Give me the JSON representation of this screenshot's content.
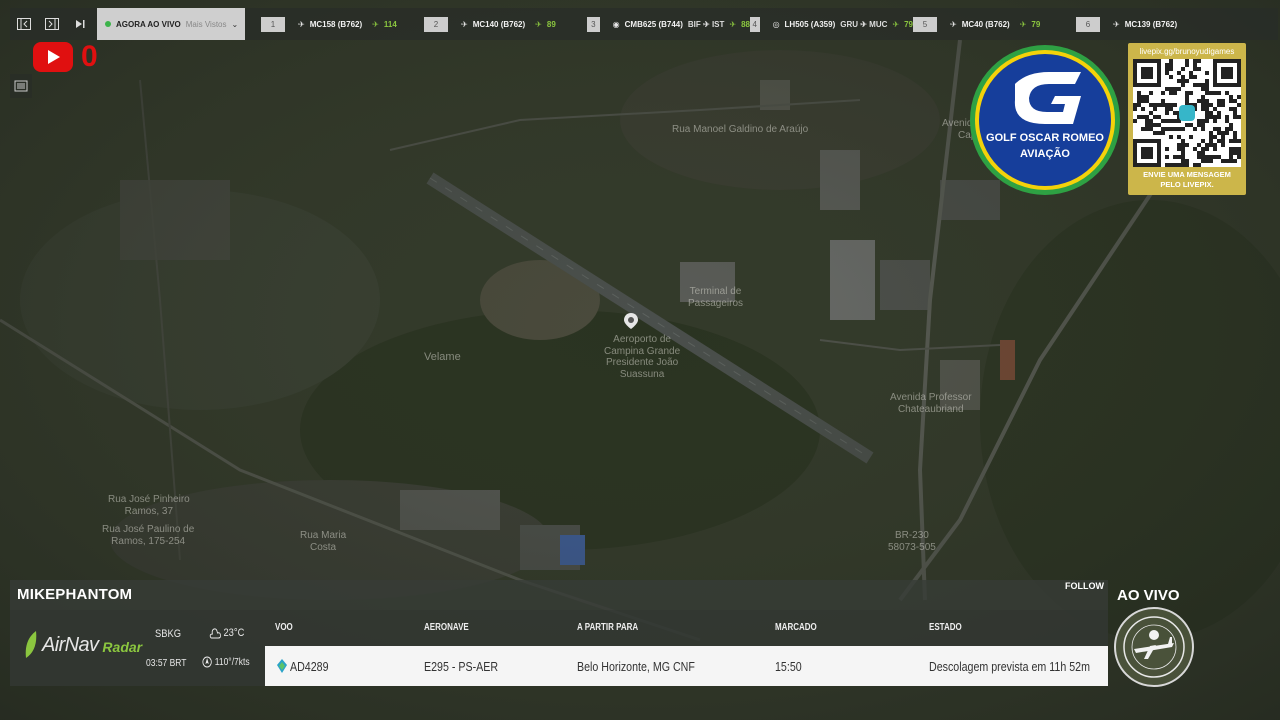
{
  "topbar": {
    "live_tab": {
      "primary": "AGORA AO VIVO",
      "secondary": "Mais Vistos"
    },
    "flights": [
      {
        "num": "1",
        "callsign": "MC158 (B762)",
        "route": "",
        "viewers": "114"
      },
      {
        "num": "2",
        "callsign": "MC140 (B762)",
        "route": "",
        "viewers": "89"
      },
      {
        "num": "3",
        "callsign": "CMB625 (B744)",
        "route": "BIF ✈ IST",
        "viewers": "88"
      },
      {
        "num": "4",
        "callsign": "LH505 (A359)",
        "route": "GRU ✈ MUC",
        "viewers": "79"
      },
      {
        "num": "5",
        "callsign": "MC40 (B762)",
        "route": "",
        "viewers": "79"
      },
      {
        "num": "6",
        "callsign": "MC139 (B762)",
        "route": "",
        "viewers": ""
      }
    ]
  },
  "youtube": {
    "count": "0"
  },
  "map": {
    "labels": {
      "road1": "Rua Manoel Galdino de Araújo",
      "airport": "Aeroporto de\nCampina Grande\nPresidente João\nSuassuna",
      "place1": "Velame",
      "terminal": "Terminal de\nPassageiros",
      "avenue1": "Avenida Professor\nChateaubriand",
      "road2": "Rua José Pinheiro\nRamos, 37",
      "road3": "Rua José Paulino de\nRamos, 175-254",
      "road4": "Rua Maria\nCosta",
      "road5": "BR-230\n58073-505",
      "avenue2": "Avenida Maria\nCapiba"
    }
  },
  "logo": {
    "name_line1": "GOLF OSCAR ROMEO",
    "name_line2": "AVIAÇÃO"
  },
  "qr": {
    "url": "livepix.gg/brunoyudigames",
    "message_line1": "ENVIE UMA MENSAGEM",
    "message_line2": "PELO LIVEPIX."
  },
  "panel": {
    "username": "MIKEPHANTOM",
    "follow_label": "FOLLOW",
    "brand": "AirNav",
    "brand_suffix": "Radar",
    "airport_code": "SBKG",
    "time": "03:57 BRT",
    "temperature": "23°C",
    "wind": "110°/7kts",
    "columns": {
      "flight": "VOO",
      "aircraft": "AERONAVE",
      "from_to": "A PARTIR PARA",
      "scheduled": "MARCADO",
      "status": "ESTADO"
    },
    "row": {
      "flight": "AD4289",
      "aircraft": "E295 - PS-AER",
      "from_to": "Belo Horizonte, MG CNF",
      "scheduled": "15:50",
      "status": "Descolagem prevista em 11h 52m"
    }
  },
  "ao_vivo": "AO VIVO",
  "colors": {
    "accent_green": "#8bc63f",
    "youtube_red": "#e01010",
    "logo_blue": "#163e9b",
    "logo_yellow": "#f4d20a",
    "qr_gold": "#ccb64a"
  }
}
